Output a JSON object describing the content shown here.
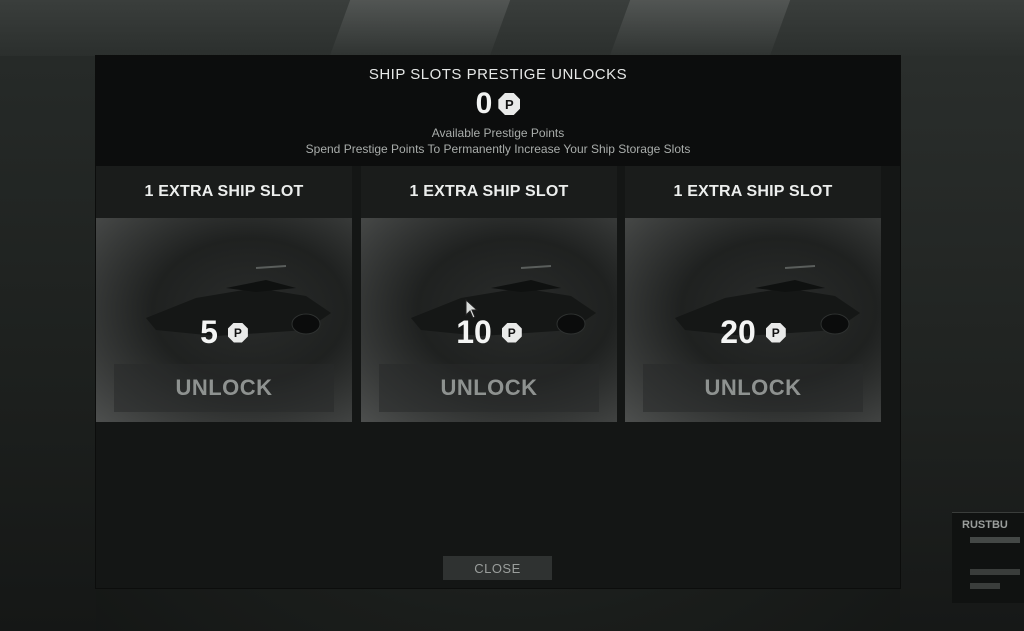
{
  "dialog": {
    "title": "SHIP SLOTS PRESTIGE UNLOCKS",
    "available_points": "0",
    "points_label": "Available Prestige Points",
    "description": "Spend Prestige Points To Permanently Increase Your Ship Storage Slots",
    "prestige_icon_glyph": "P"
  },
  "slots": [
    {
      "title": "1 EXTRA SHIP SLOT",
      "cost": "5",
      "button": "UNLOCK"
    },
    {
      "title": "1 EXTRA SHIP SLOT",
      "cost": "10",
      "button": "UNLOCK"
    },
    {
      "title": "1 EXTRA SHIP SLOT",
      "cost": "20",
      "button": "UNLOCK"
    }
  ],
  "footer": {
    "close_label": "CLOSE"
  },
  "background": {
    "partial_label": "RUSTBU"
  },
  "colors": {
    "modal_bg": "#141615",
    "header_bg": "#0c0d0d",
    "text": "#e6e8e7",
    "unlock_text": "#8e9290"
  },
  "icons": [
    "prestige-point-icon",
    "mouse-cursor-icon",
    "ship-image"
  ]
}
